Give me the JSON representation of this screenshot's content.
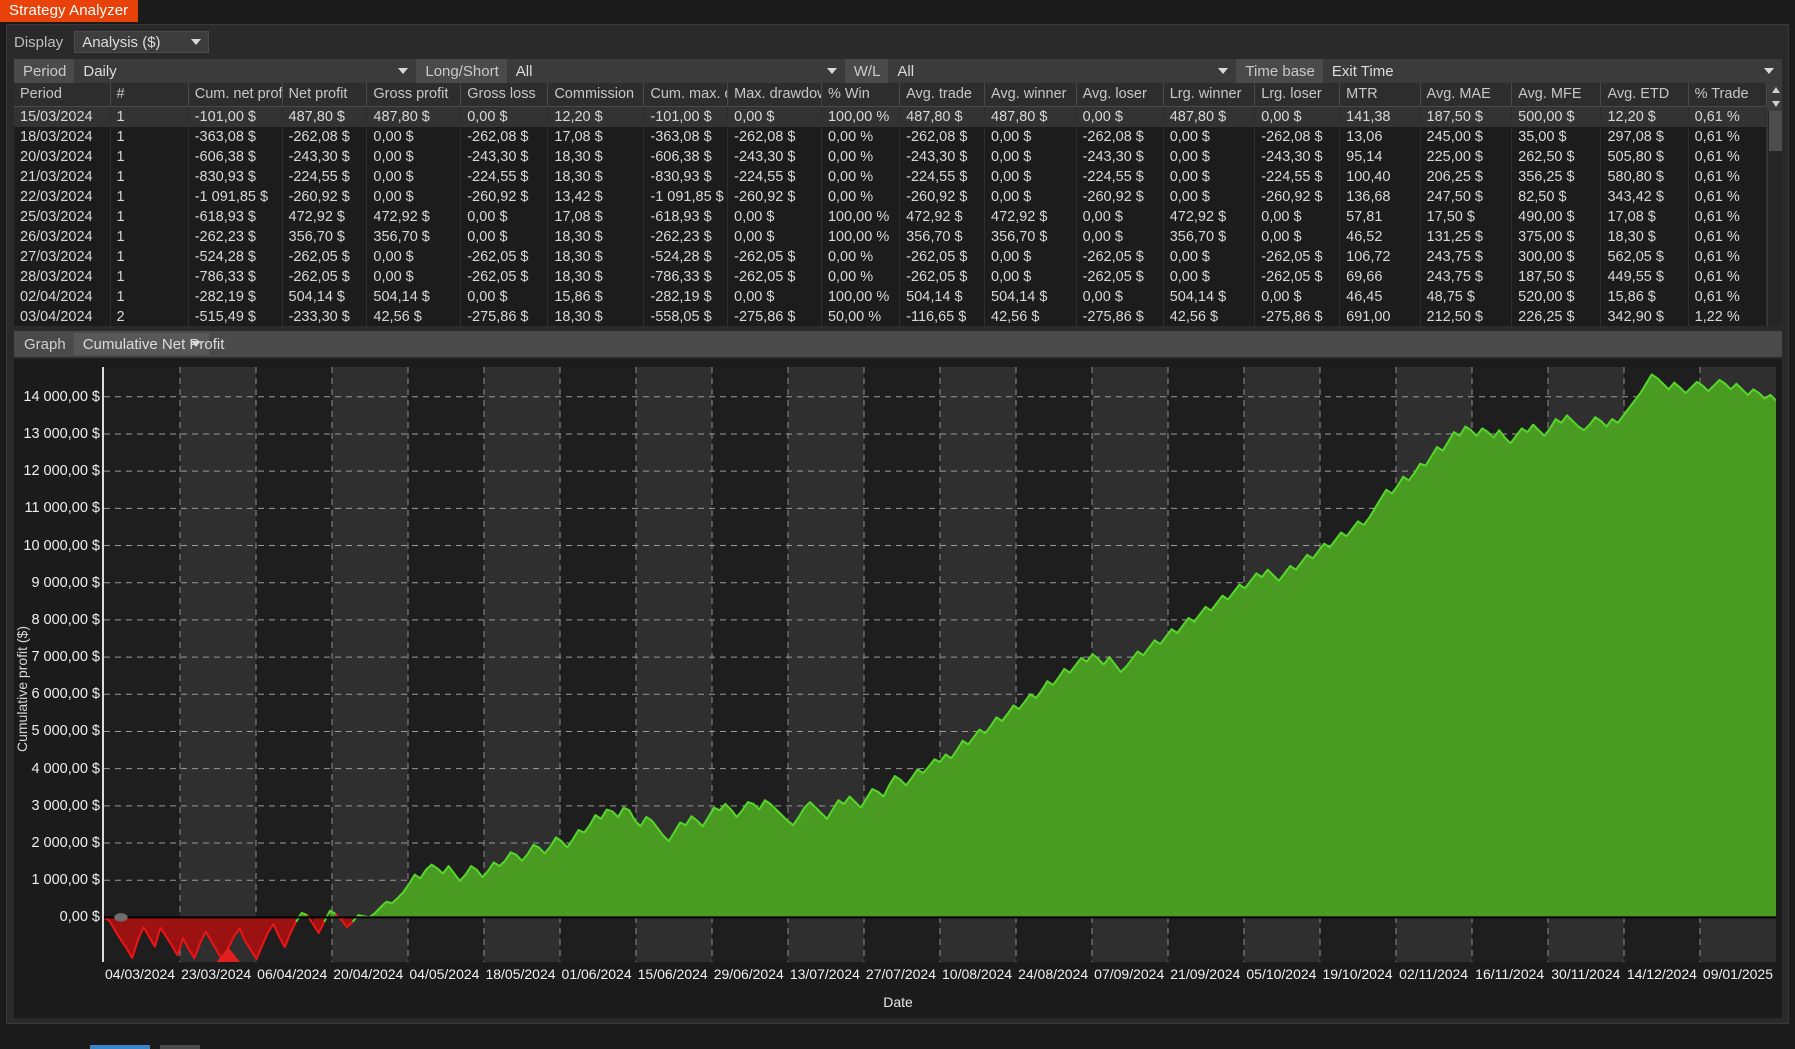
{
  "window": {
    "tab_title": "Strategy Analyzer"
  },
  "toolbar": {
    "display_label": "Display",
    "display_value": "Analysis ($)"
  },
  "filters": {
    "period_label": "Period",
    "period_value": "Daily",
    "longshort_label": "Long/Short",
    "longshort_value": "All",
    "wl_label": "W/L",
    "wl_value": "All",
    "timebase_label": "Time base",
    "timebase_value": "Exit Time"
  },
  "graph_bar": {
    "label": "Graph",
    "value": "Cumulative Net Profit"
  },
  "table": {
    "columns": [
      "Period",
      "#",
      "Cum. net profi",
      "Net profit",
      "Gross profit",
      "Gross loss",
      "Commission",
      "Cum. max. dra",
      "Max. drawdow",
      "% Win",
      "Avg. trade",
      "Avg. winner",
      "Avg. loser",
      "Lrg. winner",
      "Lrg. loser",
      "MTR",
      "Avg. MAE",
      "Avg. MFE",
      "Avg. ETD",
      "% Trade"
    ],
    "rows": [
      {
        "selected": true,
        "cells": [
          "15/03/2024",
          "1",
          "-101,00 $",
          "487,80 $",
          "487,80 $",
          "0,00 $",
          "12,20 $",
          "-101,00 $",
          "0,00 $",
          "100,00 %",
          "487,80 $",
          "487,80 $",
          "0,00 $",
          "487,80 $",
          "0,00 $",
          "141,38",
          "187,50 $",
          "500,00 $",
          "12,20 $",
          "0,61 %"
        ],
        "neg": [
          false,
          false,
          true,
          false,
          false,
          false,
          false,
          true,
          false,
          false,
          false,
          false,
          false,
          false,
          false,
          false,
          false,
          false,
          false,
          false
        ]
      },
      {
        "selected": false,
        "cells": [
          "18/03/2024",
          "1",
          "-363,08 $",
          "-262,08 $",
          "0,00 $",
          "-262,08 $",
          "17,08 $",
          "-363,08 $",
          "-262,08 $",
          "0,00 %",
          "-262,08 $",
          "0,00 $",
          "-262,08 $",
          "0,00 $",
          "-262,08 $",
          "13,06",
          "245,00 $",
          "35,00 $",
          "297,08 $",
          "0,61 %"
        ],
        "neg": [
          false,
          false,
          true,
          true,
          false,
          true,
          false,
          true,
          true,
          false,
          true,
          false,
          true,
          false,
          true,
          false,
          false,
          false,
          false,
          false
        ]
      },
      {
        "selected": false,
        "cells": [
          "20/03/2024",
          "1",
          "-606,38 $",
          "-243,30 $",
          "0,00 $",
          "-243,30 $",
          "18,30 $",
          "-606,38 $",
          "-243,30 $",
          "0,00 %",
          "-243,30 $",
          "0,00 $",
          "-243,30 $",
          "0,00 $",
          "-243,30 $",
          "95,14",
          "225,00 $",
          "262,50 $",
          "505,80 $",
          "0,61 %"
        ],
        "neg": [
          false,
          false,
          true,
          true,
          false,
          true,
          false,
          true,
          true,
          false,
          true,
          false,
          true,
          false,
          true,
          false,
          false,
          false,
          false,
          false
        ]
      },
      {
        "selected": false,
        "cells": [
          "21/03/2024",
          "1",
          "-830,93 $",
          "-224,55 $",
          "0,00 $",
          "-224,55 $",
          "18,30 $",
          "-830,93 $",
          "-224,55 $",
          "0,00 %",
          "-224,55 $",
          "0,00 $",
          "-224,55 $",
          "0,00 $",
          "-224,55 $",
          "100,40",
          "206,25 $",
          "356,25 $",
          "580,80 $",
          "0,61 %"
        ],
        "neg": [
          false,
          false,
          true,
          true,
          false,
          true,
          false,
          true,
          true,
          false,
          true,
          false,
          true,
          false,
          true,
          false,
          false,
          false,
          false,
          false
        ]
      },
      {
        "selected": false,
        "cells": [
          "22/03/2024",
          "1",
          "-1 091,85 $",
          "-260,92 $",
          "0,00 $",
          "-260,92 $",
          "13,42 $",
          "-1 091,85 $",
          "-260,92 $",
          "0,00 %",
          "-260,92 $",
          "0,00 $",
          "-260,92 $",
          "0,00 $",
          "-260,92 $",
          "136,68",
          "247,50 $",
          "82,50 $",
          "343,42 $",
          "0,61 %"
        ],
        "neg": [
          false,
          false,
          true,
          true,
          false,
          true,
          false,
          true,
          true,
          false,
          true,
          false,
          true,
          false,
          true,
          false,
          false,
          false,
          false,
          false
        ]
      },
      {
        "selected": false,
        "cells": [
          "25/03/2024",
          "1",
          "-618,93 $",
          "472,92 $",
          "472,92 $",
          "0,00 $",
          "17,08 $",
          "-618,93 $",
          "0,00 $",
          "100,00 %",
          "472,92 $",
          "472,92 $",
          "0,00 $",
          "472,92 $",
          "0,00 $",
          "57,81",
          "17,50 $",
          "490,00 $",
          "17,08 $",
          "0,61 %"
        ],
        "neg": [
          false,
          false,
          true,
          false,
          false,
          false,
          false,
          true,
          false,
          false,
          false,
          false,
          false,
          false,
          false,
          false,
          false,
          false,
          false,
          false
        ]
      },
      {
        "selected": false,
        "cells": [
          "26/03/2024",
          "1",
          "-262,23 $",
          "356,70 $",
          "356,70 $",
          "0,00 $",
          "18,30 $",
          "-262,23 $",
          "0,00 $",
          "100,00 %",
          "356,70 $",
          "356,70 $",
          "0,00 $",
          "356,70 $",
          "0,00 $",
          "46,52",
          "131,25 $",
          "375,00 $",
          "18,30 $",
          "0,61 %"
        ],
        "neg": [
          false,
          false,
          true,
          false,
          false,
          false,
          false,
          true,
          false,
          false,
          false,
          false,
          false,
          false,
          false,
          false,
          false,
          false,
          false,
          false
        ]
      },
      {
        "selected": false,
        "cells": [
          "27/03/2024",
          "1",
          "-524,28 $",
          "-262,05 $",
          "0,00 $",
          "-262,05 $",
          "18,30 $",
          "-524,28 $",
          "-262,05 $",
          "0,00 %",
          "-262,05 $",
          "0,00 $",
          "-262,05 $",
          "0,00 $",
          "-262,05 $",
          "106,72",
          "243,75 $",
          "300,00 $",
          "562,05 $",
          "0,61 %"
        ],
        "neg": [
          false,
          false,
          true,
          true,
          false,
          true,
          false,
          true,
          true,
          false,
          true,
          false,
          true,
          false,
          true,
          false,
          false,
          false,
          false,
          false
        ]
      },
      {
        "selected": false,
        "cells": [
          "28/03/2024",
          "1",
          "-786,33 $",
          "-262,05 $",
          "0,00 $",
          "-262,05 $",
          "18,30 $",
          "-786,33 $",
          "-262,05 $",
          "0,00 %",
          "-262,05 $",
          "0,00 $",
          "-262,05 $",
          "0,00 $",
          "-262,05 $",
          "69,66",
          "243,75 $",
          "187,50 $",
          "449,55 $",
          "0,61 %"
        ],
        "neg": [
          false,
          false,
          true,
          true,
          false,
          true,
          false,
          true,
          true,
          false,
          true,
          false,
          true,
          false,
          true,
          false,
          false,
          false,
          false,
          false
        ]
      },
      {
        "selected": false,
        "cells": [
          "02/04/2024",
          "1",
          "-282,19 $",
          "504,14 $",
          "504,14 $",
          "0,00 $",
          "15,86 $",
          "-282,19 $",
          "0,00 $",
          "100,00 %",
          "504,14 $",
          "504,14 $",
          "0,00 $",
          "504,14 $",
          "0,00 $",
          "46,45",
          "48,75 $",
          "520,00 $",
          "15,86 $",
          "0,61 %"
        ],
        "neg": [
          false,
          false,
          true,
          false,
          false,
          false,
          false,
          true,
          false,
          false,
          false,
          false,
          false,
          false,
          false,
          false,
          false,
          false,
          false,
          false
        ]
      },
      {
        "selected": false,
        "cells": [
          "03/04/2024",
          "2",
          "-515,49 $",
          "-233,30 $",
          "42,56 $",
          "-275,86 $",
          "18,30 $",
          "-558,05 $",
          "-275,86 $",
          "50,00 %",
          "-116,65 $",
          "42,56 $",
          "-275,86 $",
          "42,56 $",
          "-275,86 $",
          "691,00",
          "212,50 $",
          "226,25 $",
          "342,90 $",
          "1,22 %"
        ],
        "neg": [
          false,
          false,
          true,
          true,
          false,
          true,
          false,
          true,
          true,
          false,
          true,
          false,
          true,
          false,
          true,
          false,
          false,
          false,
          false,
          false
        ]
      }
    ]
  },
  "chart_data": {
    "type": "area",
    "title": "",
    "xlabel": "Date",
    "ylabel": "Cumulative profit ($)",
    "ylim": [
      -1200,
      14800
    ],
    "ytick_labels": [
      "14 000,00 $",
      "13 000,00 $",
      "12 000,00 $",
      "11 000,00 $",
      "10 000,00 $",
      "9 000,00 $",
      "8 000,00 $",
      "7 000,00 $",
      "6 000,00 $",
      "5 000,00 $",
      "4 000,00 $",
      "3 000,00 $",
      "2 000,00 $",
      "1 000,00 $",
      "0,00 $"
    ],
    "ytick_values": [
      14000,
      13000,
      12000,
      11000,
      10000,
      9000,
      8000,
      7000,
      6000,
      5000,
      4000,
      3000,
      2000,
      1000,
      0
    ],
    "xtick_labels": [
      "04/03/2024",
      "23/03/2024",
      "06/04/2024",
      "20/04/2024",
      "04/05/2024",
      "18/05/2024",
      "01/06/2024",
      "15/06/2024",
      "29/06/2024",
      "13/07/2024",
      "27/07/2024",
      "10/08/2024",
      "24/08/2024",
      "07/09/2024",
      "21/09/2024",
      "05/10/2024",
      "19/10/2024",
      "02/11/2024",
      "16/11/2024",
      "30/11/2024",
      "14/12/2024",
      "09/01/2025"
    ],
    "grid": true,
    "legend": "none",
    "colors": {
      "positive_fill": "#4a9b21",
      "positive_line": "#56d62b",
      "negative_fill": "#9c1212",
      "negative_line": "#ec1414",
      "zero_line": "#000000"
    },
    "series": [
      {
        "name": "Cumulative Net Profit",
        "values": [
          0,
          -101,
          -363,
          -606,
          -831,
          -1092,
          -619,
          -262,
          -524,
          -786,
          -282,
          -515,
          -760,
          -1020,
          -560,
          -850,
          -1100,
          -700,
          -380,
          -640,
          -900,
          -1150,
          -820,
          -520,
          -300,
          -640,
          -880,
          -1120,
          -760,
          -420,
          -180,
          -520,
          -800,
          -420,
          -120,
          120,
          60,
          -180,
          -420,
          -120,
          180,
          90,
          -60,
          -260,
          -120,
          60,
          30,
          0,
          120,
          280,
          420,
          380,
          520,
          680,
          900,
          1150,
          1050,
          1280,
          1420,
          1320,
          1180,
          1380,
          1180,
          980,
          1150,
          1380,
          1280,
          1080,
          1250,
          1480,
          1380,
          1520,
          1750,
          1680,
          1520,
          1700,
          1950,
          1880,
          1720,
          1900,
          2150,
          2050,
          1880,
          2100,
          2350,
          2280,
          2480,
          2750,
          2650,
          2900,
          2850,
          2700,
          2950,
          2880,
          2600,
          2450,
          2700,
          2600,
          2400,
          2200,
          2050,
          2300,
          2550,
          2480,
          2720,
          2600,
          2450,
          2700,
          2950,
          2880,
          3050,
          2900,
          2700,
          2880,
          3100,
          3050,
          2900,
          3150,
          3050,
          2900,
          2750,
          2600,
          2480,
          2700,
          2950,
          3100,
          2950,
          2800,
          2650,
          2900,
          3150,
          3050,
          3250,
          3100,
          2950,
          3200,
          3450,
          3380,
          3250,
          3550,
          3800,
          3700,
          3550,
          3750,
          3980,
          3880,
          4050,
          4250,
          4180,
          4380,
          4280,
          4500,
          4750,
          4650,
          4850,
          5050,
          4950,
          5150,
          5380,
          5280,
          5480,
          5700,
          5600,
          5800,
          6000,
          5900,
          6100,
          6350,
          6250,
          6450,
          6680,
          6580,
          6780,
          6980,
          6880,
          7080,
          6950,
          6800,
          7000,
          6800,
          6600,
          6750,
          6950,
          7150,
          7050,
          7250,
          7450,
          7350,
          7550,
          7750,
          7650,
          7850,
          8050,
          7950,
          8150,
          8350,
          8250,
          8450,
          8650,
          8550,
          8750,
          8950,
          8850,
          9050,
          9250,
          9150,
          9350,
          9200,
          9050,
          9250,
          9450,
          9350,
          9550,
          9750,
          9650,
          9850,
          10050,
          9950,
          10150,
          10350,
          10250,
          10450,
          10650,
          10550,
          10750,
          11000,
          11250,
          11500,
          11400,
          11600,
          11850,
          11750,
          11950,
          12200,
          12150,
          12400,
          12650,
          12550,
          12800,
          13050,
          12950,
          13200,
          13100,
          12950,
          13150,
          13050,
          12900,
          13100,
          12900,
          12750,
          12950,
          13150,
          13050,
          13250,
          13100,
          12950,
          13150,
          13400,
          13300,
          13500,
          13350,
          13200,
          13100,
          13250,
          13450,
          13350,
          13200,
          13400,
          13300,
          13500,
          13700,
          13900,
          14100,
          14350,
          14600,
          14500,
          14350,
          14200,
          14380,
          14250,
          14100,
          14250,
          14400,
          14300,
          14150,
          14300,
          14450,
          14350,
          14200,
          14350,
          14200,
          14050,
          14200,
          14100,
          13950,
          14050,
          13900
        ]
      }
    ]
  },
  "scrollbar": {
    "up_icon": "triangle-up-icon",
    "down_icon": "triangle-down-icon"
  }
}
